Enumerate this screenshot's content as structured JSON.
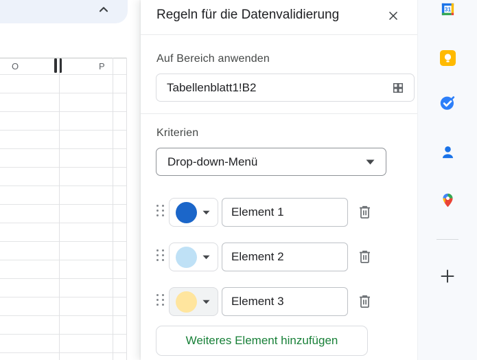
{
  "spreadsheet": {
    "columns": [
      {
        "label": "O"
      },
      {
        "label": "P"
      }
    ]
  },
  "panel": {
    "title": "Regeln für die Datenvalidierung",
    "range_section": {
      "label": "Auf Bereich anwenden",
      "value": "Tabellenblatt1!B2"
    },
    "criteria_section": {
      "label": "Kriterien",
      "selected": "Drop-down-Menü"
    },
    "items": [
      {
        "value": "Element 1",
        "color_name": "dark-blue",
        "swatch_style": "background:#1b66c9"
      },
      {
        "value": "Element 2",
        "color_name": "light-blue",
        "swatch_style": "background:#bfe1f6"
      },
      {
        "value": "Element 3",
        "color_name": "light-yellow",
        "swatch_style": "background:#ffe59e"
      }
    ],
    "add_item_label": "Weiteres Element hinzufügen"
  },
  "side_rail": {
    "calendar_day": "31",
    "icons": [
      "google-calendar-icon",
      "google-keep-icon",
      "google-tasks-icon",
      "google-contacts-icon",
      "google-maps-icon",
      "plus-icon"
    ]
  },
  "colors": {
    "add_button_green": "#188038",
    "toolbar_blob": "#edf2fa",
    "rail_bg": "#f7f9fc",
    "swatch_dark_blue": "#1b66c9",
    "swatch_light_blue": "#bfe1f6",
    "swatch_light_yellow": "#ffe59e"
  }
}
